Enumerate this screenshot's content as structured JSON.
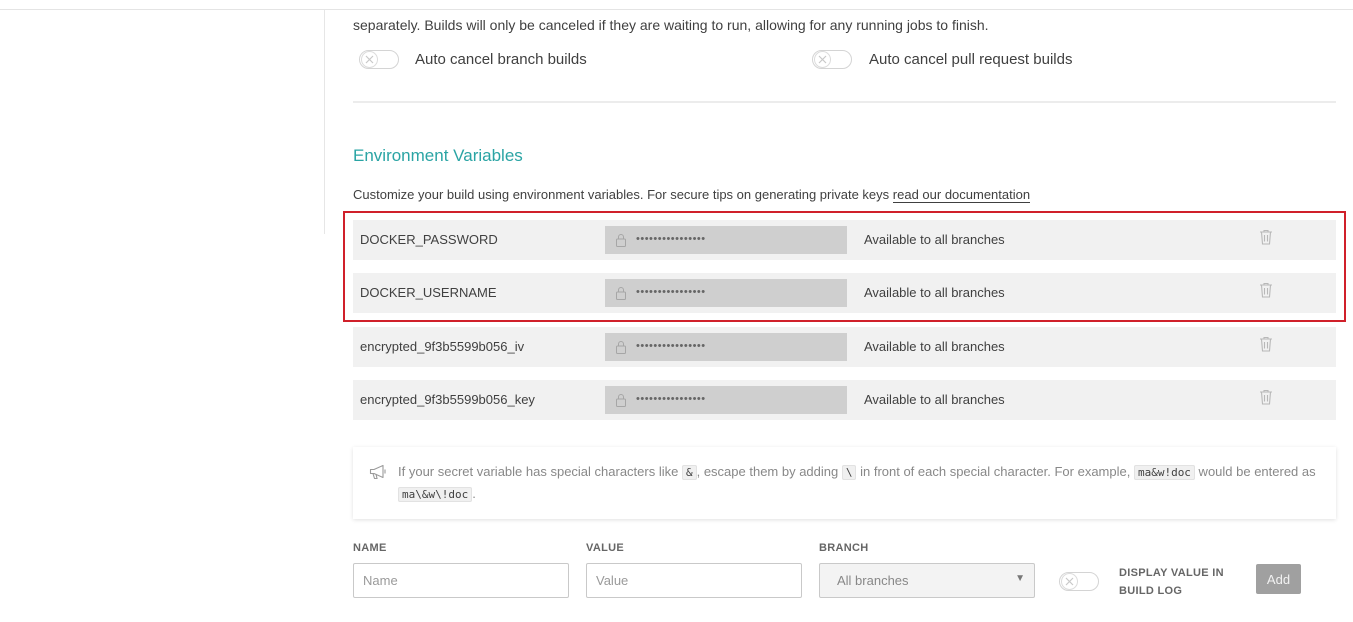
{
  "auto_cancel": {
    "description_partial": "separately. Builds will only be canceled if they are waiting to run, allowing for any running jobs to finish.",
    "branch_label": "Auto cancel branch builds",
    "pull_request_label": "Auto cancel pull request builds",
    "branch_enabled": false,
    "pull_request_enabled": false
  },
  "env_section": {
    "title": "Environment Variables",
    "description": "Customize your build using environment variables. For secure tips on generating private keys ",
    "doc_link": "read our documentation"
  },
  "env_vars": [
    {
      "name": "DOCKER_PASSWORD",
      "value_masked": "••••••••••••••••",
      "branch": "Available to all branches"
    },
    {
      "name": "DOCKER_USERNAME",
      "value_masked": "••••••••••••••••",
      "branch": "Available to all branches"
    },
    {
      "name": "encrypted_9f3b5599b056_iv",
      "value_masked": "••••••••••••••••",
      "branch": "Available to all branches"
    },
    {
      "name": "encrypted_9f3b5599b056_key",
      "value_masked": "••••••••••••••••",
      "branch": "Available to all branches"
    }
  ],
  "notice": {
    "part1": "If your secret variable has special characters like ",
    "code1": "&",
    "part2": ", escape them by adding ",
    "code2": "\\",
    "part3": " in front of each special character. For example, ",
    "code3": "ma&w!doc",
    "part4": " would be entered as ",
    "code4": "ma\\&w\\!doc",
    "part5": "."
  },
  "add_form": {
    "name_label": "NAME",
    "name_placeholder": "Name",
    "value_label": "VALUE",
    "value_placeholder": "Value",
    "branch_label": "BRANCH",
    "branch_selected": "All branches",
    "display_label": "DISPLAY VALUE IN BUILD LOG",
    "display_enabled": false,
    "add_button": "Add"
  },
  "colors": {
    "accent": "#2aa4a4",
    "highlight": "#d0202a",
    "row_bg": "#f1f1f1",
    "value_bg": "#cfcfcf"
  },
  "icons": {
    "toggle_off": "x-icon",
    "value_lock": "lock-icon",
    "delete": "trash-icon",
    "notice": "megaphone-icon",
    "select": "caret-down-icon"
  }
}
